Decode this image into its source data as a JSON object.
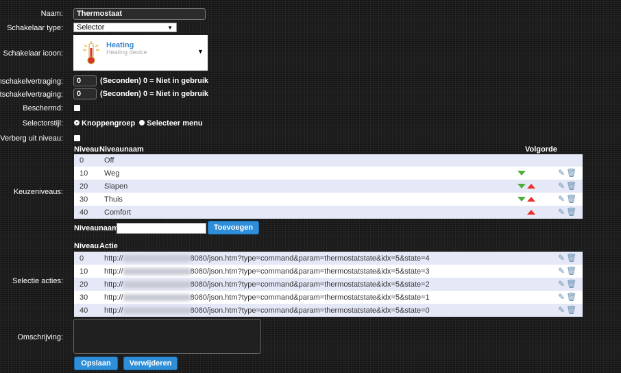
{
  "form": {
    "naam_label": "Naam:",
    "naam_value": "Thermostaat",
    "type_label": "Schakelaar type:",
    "type_value": "Selector",
    "icon_label": "Schakelaar icoon:",
    "icon_title": "Heating",
    "icon_subtitle": "Heating device",
    "inschakel_label": "Inschakelvertraging:",
    "inschakel_value": "0",
    "uitschakel_label": "Uitschakelvertraging:",
    "uitschakel_value": "0",
    "delay_note": "(Seconden) 0 = Niet in gebruik",
    "beschermd_label": "Beschermd:",
    "selectorstijl_label": "Selectorstijl:",
    "style_option_1": "Knoppengroep",
    "style_option_2": "Selecteer menu",
    "verberg_label": "Verberg uit niveau:",
    "keuzeniveaus_label": "Keuzeniveaus:",
    "selectie_label": "Selectie acties:",
    "omschrijving_label": "Omschrijving:"
  },
  "levels": {
    "header_niveau": "Niveau",
    "header_naam": "Niveaunaam",
    "header_volgorde": "Volgorde",
    "rows": [
      {
        "level": "0",
        "name": "Off"
      },
      {
        "level": "10",
        "name": "Weg"
      },
      {
        "level": "20",
        "name": "Slapen"
      },
      {
        "level": "30",
        "name": "Thuis"
      },
      {
        "level": "40",
        "name": "Comfort"
      }
    ],
    "add_label": "Niveaunaam:",
    "add_button": "Toevoegen"
  },
  "actions": {
    "header_niveau": "Niveau",
    "header_actie": "Actie",
    "rows": [
      {
        "level": "0",
        "prefix": "http://",
        "suffix": "8080/json.htm?type=command&param=thermostatstate&idx=5&state=4"
      },
      {
        "level": "10",
        "prefix": "http://",
        "suffix": "8080/json.htm?type=command&param=thermostatstate&idx=5&state=3"
      },
      {
        "level": "20",
        "prefix": "http://",
        "suffix": "8080/json.htm?type=command&param=thermostatstate&idx=5&state=2"
      },
      {
        "level": "30",
        "prefix": "http://",
        "suffix": "8080/json.htm?type=command&param=thermostatstate&idx=5&state=1"
      },
      {
        "level": "40",
        "prefix": "http://",
        "suffix": "8080/json.htm?type=command&param=thermostatstate&idx=5&state=0"
      }
    ]
  },
  "buttons": {
    "save": "Opslaan",
    "delete": "Verwijderen"
  },
  "colors": {
    "accent": "#2f8ed8",
    "row_alt": "#e5e8f7",
    "down_arrow": "#4caf3a",
    "up_arrow": "#e8322d"
  }
}
